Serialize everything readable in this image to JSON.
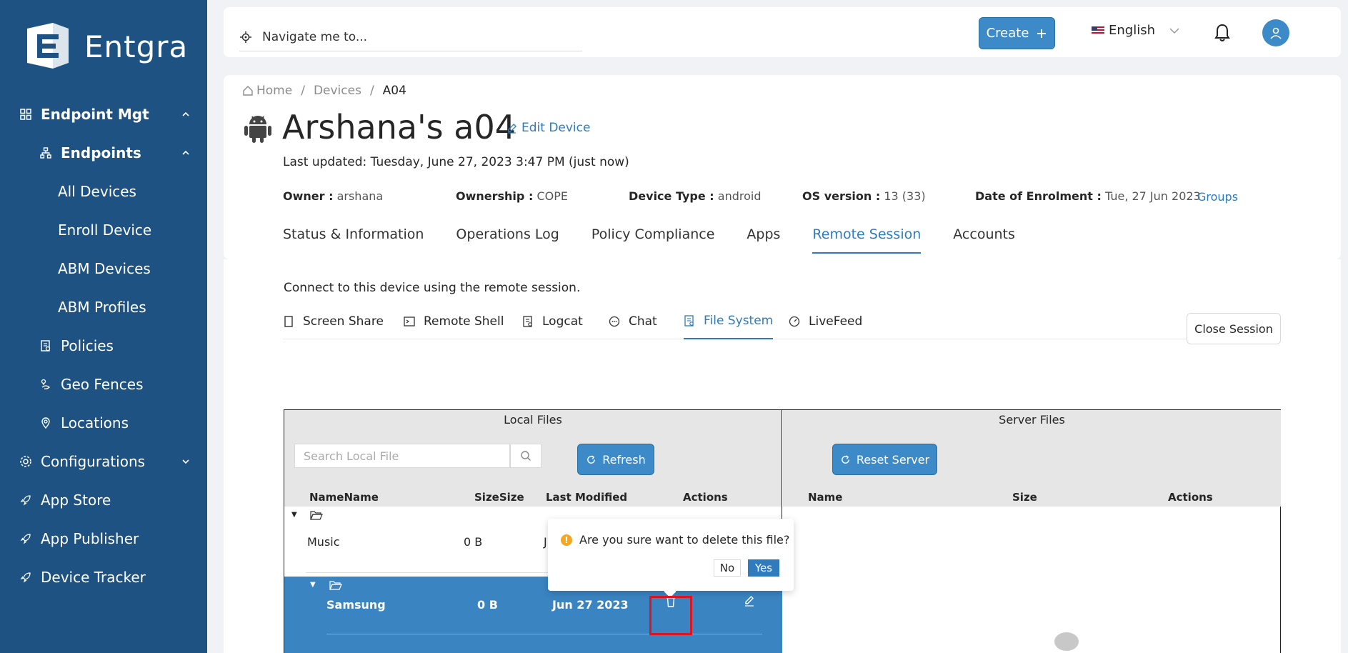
{
  "brand": {
    "name": "Entgra"
  },
  "sidebar": {
    "items": [
      {
        "label": "Endpoint Mgt",
        "icon": "grid-icon"
      },
      {
        "label": "Endpoints",
        "icon": "sitemap-icon"
      },
      {
        "label": "All Devices"
      },
      {
        "label": "Enroll Device"
      },
      {
        "label": "ABM Devices"
      },
      {
        "label": "ABM Profiles"
      },
      {
        "label": "Policies",
        "icon": "policy-icon"
      },
      {
        "label": "Geo Fences",
        "icon": "geofence-icon"
      },
      {
        "label": "Locations",
        "icon": "location-icon"
      },
      {
        "label": "Configurations",
        "icon": "gear-icon"
      },
      {
        "label": "App Store",
        "icon": "rocket-icon"
      },
      {
        "label": "App Publisher",
        "icon": "rocket-icon"
      },
      {
        "label": "Device Tracker",
        "icon": "rocket-icon"
      }
    ]
  },
  "topbar": {
    "search_placeholder": "Navigate me to...",
    "create_label": "Create",
    "language": "English"
  },
  "breadcrumb": {
    "home": "Home",
    "devices": "Devices",
    "current": "A04"
  },
  "device": {
    "title": "Arshana's a04",
    "edit_label": "Edit Device",
    "last_updated": "Last updated: Tuesday, June 27, 2023 3:47 PM (just now)",
    "owner_label": "Owner :",
    "owner": "arshana",
    "ownership_label": "Ownership :",
    "ownership": "COPE",
    "type_label": "Device Type :",
    "type": "android",
    "os_label": "OS version :",
    "os": "13 (33)",
    "enrol_label": "Date of Enrolment :",
    "enrol": "Tue, 27 Jun 2023",
    "groups_label": "Groups"
  },
  "tabs": [
    "Status & Information",
    "Operations Log",
    "Policy Compliance",
    "Apps",
    "Remote Session",
    "Accounts"
  ],
  "remote": {
    "connect_text": "Connect to this device using the remote session.",
    "subtabs": [
      "Screen Share",
      "Remote Shell",
      "Logcat",
      "Chat",
      "File System",
      "LiveFeed"
    ],
    "close_session": "Close Session"
  },
  "filesystem": {
    "local_title": "Local Files",
    "server_title": "Server Files",
    "search_placeholder": "Search Local File",
    "refresh_label": "Refresh",
    "reset_label": "Reset Server",
    "local_cols": [
      "NameName",
      "SizeSize",
      "Last Modified",
      "Actions"
    ],
    "server_cols": [
      "Name",
      "Size",
      "Actions"
    ],
    "rows": [
      {
        "name": "Music",
        "size": "0 B",
        "modified": "J"
      },
      {
        "name": "Samsung",
        "size": "0 B",
        "modified": "Jun 27 2023"
      }
    ]
  },
  "popconfirm": {
    "message": "Are you sure want to delete this file?",
    "no": "No",
    "yes": "Yes"
  },
  "colors": {
    "sidebar": "#1d5282",
    "accent": "#3c8ac7",
    "selected_row": "#3a84c2",
    "highlight": "#e0141e"
  }
}
